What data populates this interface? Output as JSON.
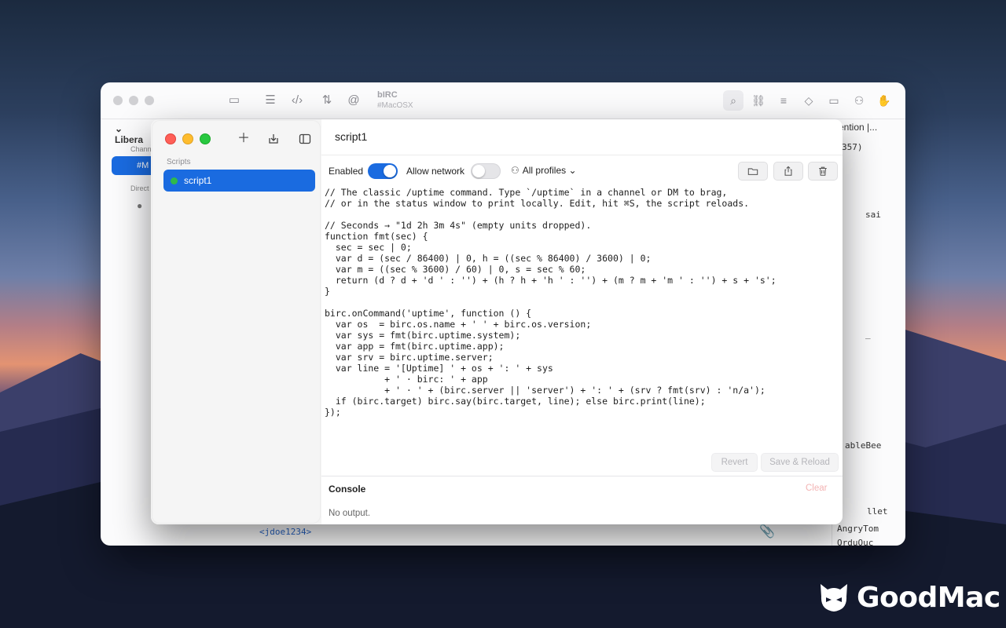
{
  "background_window": {
    "app_name": "bIRC",
    "channel_sub": "#MacOSX",
    "sidebar": {
      "group": "Libera",
      "channels_label": "Chann",
      "selected_channel": "#M",
      "direct_label": "Direct"
    },
    "right_column": {
      "row1": "ention |...",
      "row2": "357)",
      "nick_sai": "sai",
      "nick_underscore": "_",
      "nick_ablebee": "ableBee",
      "nick_llet": "llet",
      "nick_angrytom": "AngryTom",
      "nick_ordu": "OrduOuc"
    },
    "footer_nick": "<jdoe1234>"
  },
  "window": {
    "title": "script1",
    "sidebar_section": "Scripts",
    "scripts": [
      {
        "name": "script1",
        "status_color": "#2fb94b"
      }
    ]
  },
  "toolbar": {
    "enabled_label": "Enabled",
    "enabled_on": true,
    "allow_network_label": "Allow network",
    "allow_network_on": false,
    "profiles_label": "All profiles",
    "profiles_chevron": "⌄"
  },
  "editor": {
    "code": "// The classic /uptime command. Type `/uptime` in a channel or DM to brag,\n// or in the status window to print locally. Edit, hit ⌘S, the script reloads.\n\n// Seconds → \"1d 2h 3m 4s\" (empty units dropped).\nfunction fmt(sec) {\n  sec = sec | 0;\n  var d = (sec / 86400) | 0, h = ((sec % 86400) / 3600) | 0;\n  var m = ((sec % 3600) / 60) | 0, s = sec % 60;\n  return (d ? d + 'd ' : '') + (h ? h + 'h ' : '') + (m ? m + 'm ' : '') + s + 's';\n}\n\nbirc.onCommand('uptime', function () {\n  var os  = birc.os.name + ' ' + birc.os.version;\n  var sys = fmt(birc.uptime.system);\n  var app = fmt(birc.uptime.app);\n  var srv = birc.uptime.server;\n  var line = '[Uptime] ' + os + ': ' + sys\n           + ' · birc: ' + app\n           + ' · ' + (birc.server || 'server') + ': ' + (srv ? fmt(srv) : 'n/a');\n  if (birc.target) birc.say(birc.target, line); else birc.print(line);\n});"
  },
  "actions": {
    "revert_label": "Revert",
    "save_label": "Save & Reload"
  },
  "console": {
    "title": "Console",
    "clear_label": "Clear",
    "output": "No output."
  },
  "watermark": {
    "brand": "GoodMac"
  },
  "colors": {
    "accent": "#1a6be0",
    "close": "#ff5f57",
    "minimize": "#febc2e",
    "zoom": "#28c840"
  }
}
